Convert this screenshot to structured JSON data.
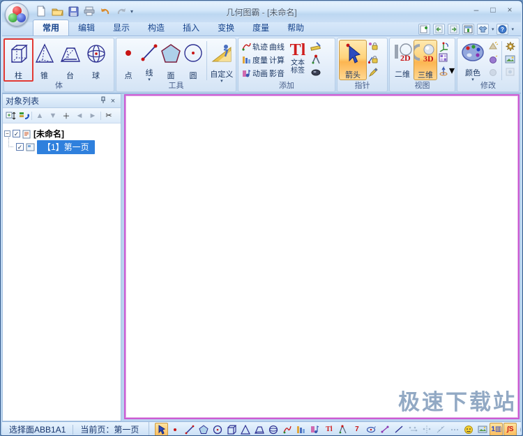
{
  "window": {
    "title": "几何图霸 - [未命名]",
    "minimize": "–",
    "maximize": "□",
    "close": "×"
  },
  "icons": {
    "dropdown": "▾",
    "qat_dropdown": "▾",
    "check": "✓",
    "expand_minus": "−",
    "up": "▲",
    "down": "▼",
    "left": "◄",
    "right": "►",
    "plus": "＋",
    "scissors": "✂",
    "pin": "⊣",
    "panel_close": "×"
  },
  "tabs": {
    "home": "常用",
    "edit": "编辑",
    "display": "显示",
    "construct": "构造",
    "insert": "插入",
    "transform": "变换",
    "measure": "度量",
    "help": "帮助"
  },
  "ribbon": {
    "body": {
      "label": "体",
      "cylinder": "柱",
      "cone": "锥",
      "frustum": "台",
      "sphere": "球"
    },
    "tools": {
      "label": "工具",
      "point": "点",
      "line": "线",
      "face": "面",
      "circle": "圆",
      "custom": "自定义"
    },
    "add": {
      "label": "添加",
      "locus": "轨迹",
      "curve": "曲线",
      "measure": "度量",
      "calc": "计算",
      "anim": "动画",
      "media": "影音",
      "text_glyph": "Tl",
      "text_line1": "文本",
      "text_line2": "标签"
    },
    "pointer": {
      "label": "指针",
      "arrow": "箭头"
    },
    "view": {
      "label": "视图",
      "d2": "二维",
      "d3": "三维",
      "glyph2d": "2D",
      "glyph3d": "3D"
    },
    "modify": {
      "label": "修改",
      "color": "颜色"
    }
  },
  "panel": {
    "title": "对象列表",
    "root_label": "[未命名]",
    "page_label": "【1】第一页"
  },
  "statusbar": {
    "selection": "选择面ABB1A1",
    "current_page": "当前页：第一页",
    "text_glyph": "Tl",
    "seven_glyph": "7",
    "calc_glyph": "1▥",
    "integral_glyph": "∫S"
  },
  "watermark": {
    "text": "极速下载站"
  }
}
